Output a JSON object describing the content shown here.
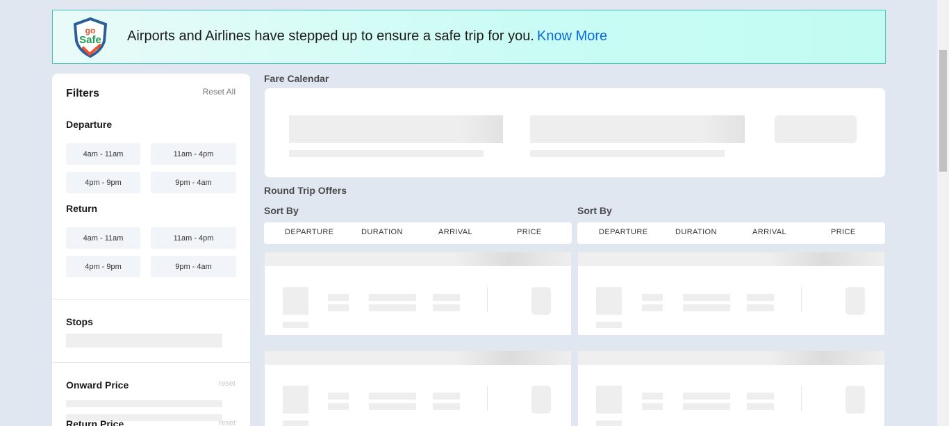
{
  "banner": {
    "logo_text_top": "go",
    "logo_text_bottom": "Safe",
    "message": "Airports and Airlines have stepped up to ensure a safe trip for you.",
    "link": "Know More",
    "colors": {
      "link": "#0a6bd4",
      "border": "#3fc7b8"
    }
  },
  "filters": {
    "title": "Filters",
    "reset_all": "Reset All",
    "departure": {
      "title": "Departure",
      "slots": [
        "4am - 11am",
        "11am - 4pm",
        "4pm - 9pm",
        "9pm - 4am"
      ]
    },
    "return": {
      "title": "Return",
      "slots": [
        "4am - 11am",
        "11am - 4pm",
        "4pm - 9pm",
        "9pm - 4am"
      ]
    },
    "stops": {
      "title": "Stops"
    },
    "onward_price": {
      "title": "Onward Price",
      "reset": "reset"
    },
    "return_price": {
      "title": "Return Price",
      "reset": "reset"
    }
  },
  "fare_calendar": {
    "title": "Fare Calendar"
  },
  "round_trip": {
    "title": "Round Trip Offers",
    "onward_sort": {
      "label": "Sort By",
      "options": [
        "DEPARTURE",
        "DURATION",
        "ARRIVAL",
        "PRICE"
      ]
    },
    "return_sort": {
      "label": "Sort By",
      "options": [
        "DEPARTURE",
        "DURATION",
        "ARRIVAL",
        "PRICE"
      ]
    }
  },
  "icons": {
    "banner_logo": "gosafe-shield-icon"
  }
}
